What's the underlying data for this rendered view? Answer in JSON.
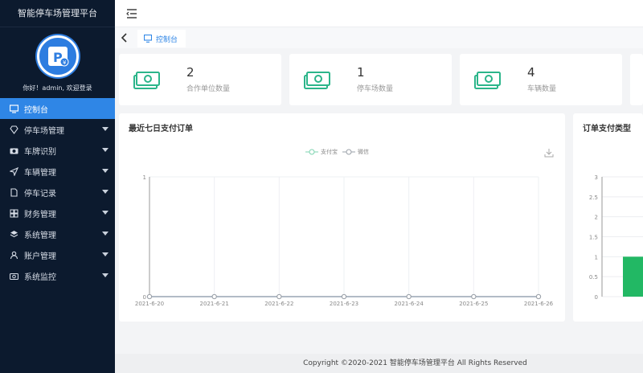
{
  "app": {
    "title": "智能停车场管理平台",
    "welcome": "你好！admin, 欢迎登录"
  },
  "sidebar": {
    "items": [
      {
        "label": "控制台",
        "icon": "monitor-icon",
        "active": true,
        "expandable": false
      },
      {
        "label": "停车场管理",
        "icon": "diamond-icon",
        "active": false,
        "expandable": true
      },
      {
        "label": "车牌识别",
        "icon": "camera-icon",
        "active": false,
        "expandable": true
      },
      {
        "label": "车辆管理",
        "icon": "send-icon",
        "active": false,
        "expandable": true
      },
      {
        "label": "停车记录",
        "icon": "document-icon",
        "active": false,
        "expandable": true
      },
      {
        "label": "财务管理",
        "icon": "grid-icon",
        "active": false,
        "expandable": true
      },
      {
        "label": "系统管理",
        "icon": "layers-icon",
        "active": false,
        "expandable": true
      },
      {
        "label": "账户管理",
        "icon": "user-icon",
        "active": false,
        "expandable": true
      },
      {
        "label": "系统监控",
        "icon": "camera-icon",
        "active": false,
        "expandable": true
      }
    ]
  },
  "tabs": [
    {
      "label": "控制台",
      "icon": "monitor-icon"
    }
  ],
  "stats": [
    {
      "value": "2",
      "label": "合作单位数量"
    },
    {
      "value": "1",
      "label": "停车场数量"
    },
    {
      "value": "4",
      "label": "车辆数量"
    }
  ],
  "colors": {
    "accent": "#2f86e6",
    "sidebar_bg": "#0c1a2e",
    "money_green": "#2bb58a",
    "bar_green": "#22b864"
  },
  "chart_data": [
    {
      "type": "line",
      "title": "最近七日支付订单",
      "x": [
        "2021-6-20",
        "2021-6-21",
        "2021-6-22",
        "2021-6-23",
        "2021-6-24",
        "2021-6-25",
        "2021-6-26"
      ],
      "series": [
        {
          "name": "支付宝",
          "values": [
            0,
            0,
            0,
            0,
            0,
            0,
            0
          ],
          "color": "#7dd3b0"
        },
        {
          "name": "微信",
          "values": [
            0,
            0,
            0,
            0,
            0,
            0,
            0
          ],
          "color": "#9aa0a8"
        }
      ],
      "yticks": [
        "0",
        "1"
      ],
      "ylim": [
        0,
        1
      ],
      "legend": "top-center",
      "grid": true
    },
    {
      "type": "bar",
      "title": "订单支付类型",
      "yticks": [
        "0",
        "0.5",
        "1",
        "1.5",
        "2",
        "2.5",
        "3"
      ],
      "ylim": [
        0,
        3
      ],
      "values": [
        1
      ],
      "grid": true
    }
  ],
  "footer": {
    "text": "Copyright ©2020-2021 智能停车场管理平台 All Rights Reserved"
  }
}
